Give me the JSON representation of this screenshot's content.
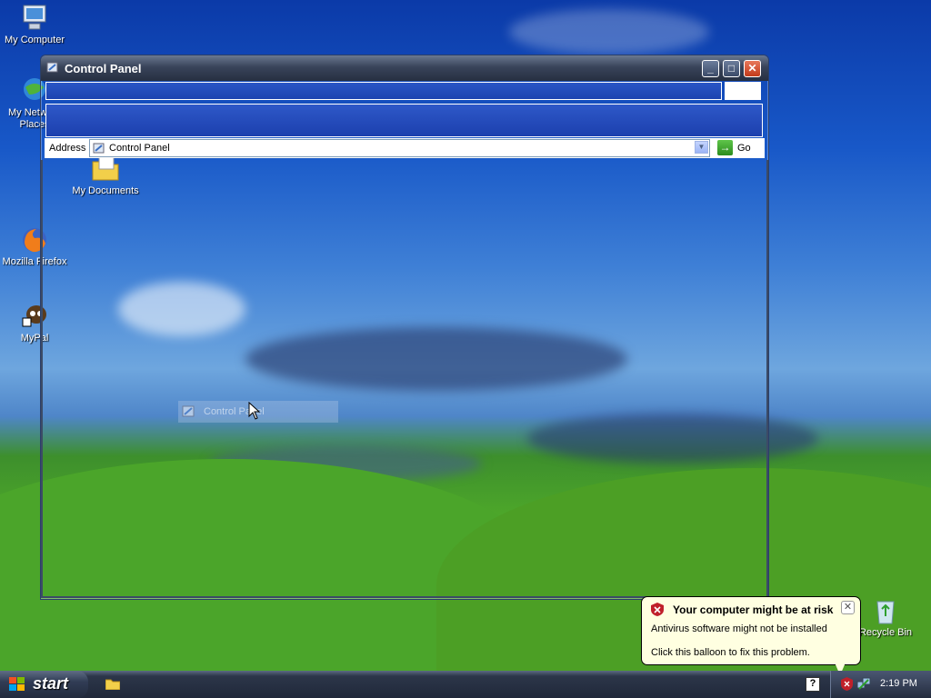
{
  "desktop": {
    "icons": [
      {
        "label": "My Computer"
      },
      {
        "label": "My Network Places"
      },
      {
        "label": "My Documents"
      },
      {
        "label": "Mozilla Firefox"
      },
      {
        "label": "MyPal"
      },
      {
        "label": "Recycle Bin"
      }
    ]
  },
  "window": {
    "title": "Control Panel",
    "minimize": "_",
    "maximize": "□",
    "close": "✕",
    "address_label": "Address",
    "address_value": "Control Panel",
    "go_label": "Go"
  },
  "drag": {
    "label": "Control Panel"
  },
  "balloon": {
    "title": "Your computer might be at risk",
    "line1": "Antivirus software might not be installed",
    "line2": "Click this balloon to fix this problem.",
    "close": "✕"
  },
  "taskbar": {
    "start_label": "start",
    "clock": "2:19 PM",
    "help": "?"
  },
  "colors": {
    "accent": "#1c44b0",
    "balloon_bg": "#ffffe1",
    "shield_red": "#c0202a"
  },
  "icons": [
    "my-computer-icon",
    "network-places-icon",
    "my-documents-icon",
    "firefox-icon",
    "mypal-icon",
    "recycle-bin-icon",
    "control-panel-icon",
    "go-arrow-icon",
    "security-shield-icon",
    "network-tray-icon",
    "folder-icon",
    "windows-logo-icon",
    "help-icon"
  ]
}
